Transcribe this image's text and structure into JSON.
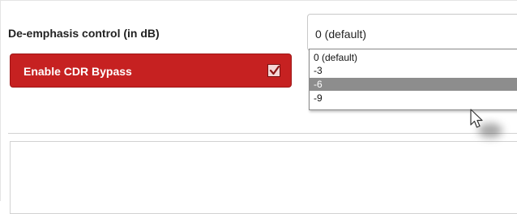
{
  "setting": {
    "label": "De-emphasis control (in dB)",
    "select": {
      "value": "0 (default)",
      "options": [
        "0 (default)",
        "-3",
        "-6",
        "-9"
      ],
      "highlighted": "-6"
    }
  },
  "toggle": {
    "label": "Enable CDR Bypass",
    "checked": true
  },
  "colors": {
    "accent": "#c62121",
    "highlight": "#8d8d8d"
  },
  "icons": {
    "pointer": "mouse-pointer-icon",
    "checkmark": "checkmark-icon"
  }
}
